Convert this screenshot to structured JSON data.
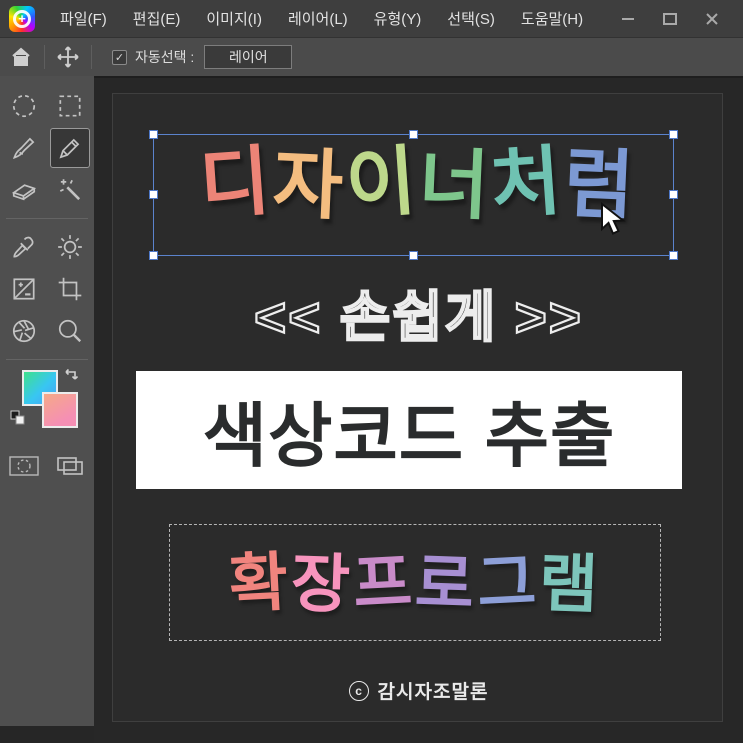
{
  "titlebar": {
    "menus": [
      "파일(F)",
      "편집(E)",
      "이미지(I)",
      "레이어(L)",
      "유형(Y)",
      "선택(S)",
      "도움말(H)"
    ],
    "icons": [
      "app-logo-icon",
      "minimize-icon",
      "maximize-icon",
      "close-icon"
    ]
  },
  "toolbar": {
    "icons": [
      "home-icon",
      "move-tool-icon"
    ],
    "check_glyph": "✓",
    "auto_select_label": "자동선택 :",
    "auto_select_checked": true,
    "layer_dropdown_value": "레이어"
  },
  "sidebar": {
    "tools": [
      "ellipse-select",
      "rect-select",
      "brush",
      "pencil",
      "eraser",
      "magic-wand",
      "eyedropper",
      "brightness",
      "exposure",
      "crop",
      "aperture",
      "zoom",
      "foreground-color",
      "background-color",
      "swap-colors",
      "default-colors",
      "vignette-select",
      "duplicate"
    ],
    "selected_tool": "pencil",
    "foreground_gradient": [
      "#3fe18c",
      "#38c6f2",
      "#4a9ff5"
    ],
    "background_gradient": [
      "#f5a987",
      "#f58fb4"
    ]
  },
  "canvas": {
    "title": {
      "text": "디자이너처럼",
      "letters": [
        {
          "char": "디",
          "color": "#ec8477"
        },
        {
          "char": "자",
          "color": "#f4bd80"
        },
        {
          "char": "이",
          "color": "#bdd88b"
        },
        {
          "char": "너",
          "color": "#7ec68c"
        },
        {
          "char": "처",
          "color": "#6fc2b2"
        },
        {
          "char": "럼",
          "color": "#7c99d3"
        }
      ],
      "selected": true
    },
    "subtitle": "<< 손쉽게 >>",
    "banner": "색상코드 추출",
    "extension": {
      "text": "확장프로그램",
      "letters": [
        {
          "char": "확",
          "color": "#f0847e"
        },
        {
          "char": "장",
          "color": "#f794bd"
        },
        {
          "char": "프",
          "color": "#c98bc9"
        },
        {
          "char": "로",
          "color": "#a78fd2"
        },
        {
          "char": "그",
          "color": "#8d9fd8"
        },
        {
          "char": "램",
          "color": "#7dc5bb"
        }
      ]
    },
    "credit_symbol": "c",
    "credit_name": "감시자조말론"
  },
  "colors": {
    "selection_accent": "#5b83cc",
    "canvas_bg": "#2b2b2b",
    "banner_bg": "#ffffff",
    "banner_text": "#2a2c2d",
    "outline_text": "#ededed"
  }
}
